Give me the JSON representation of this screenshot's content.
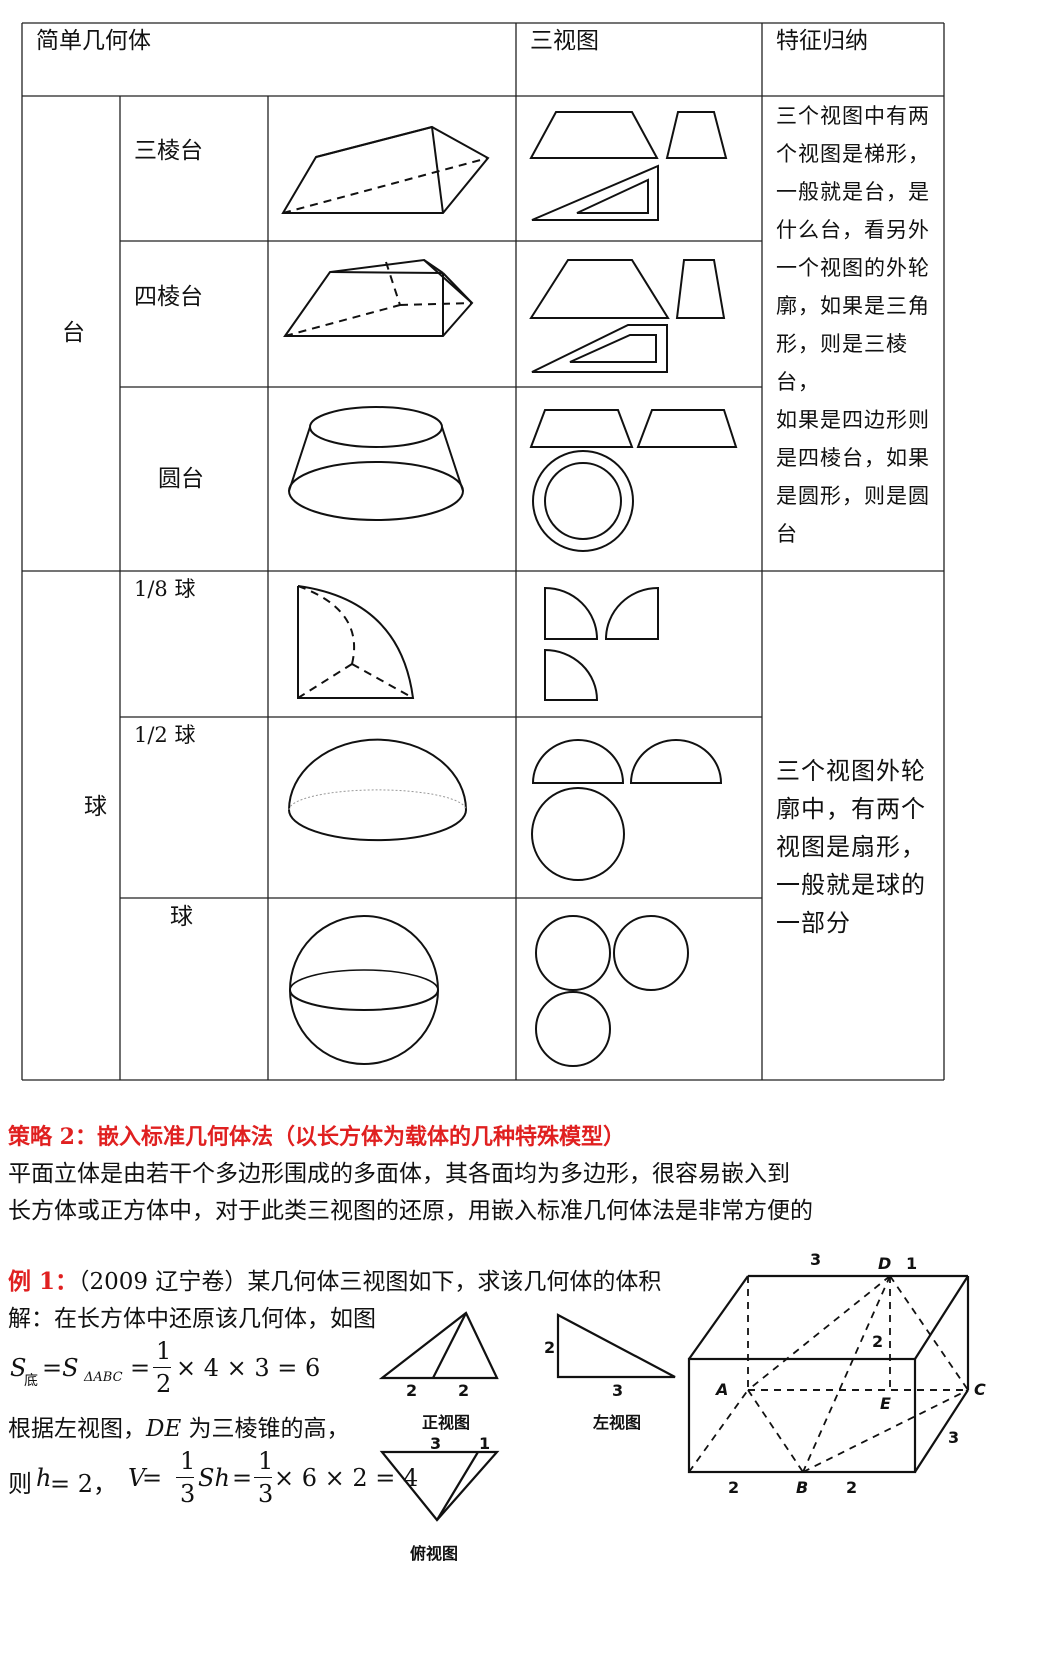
{
  "table": {
    "headers": [
      "简单几何体",
      "三视图",
      "特征归纳"
    ],
    "groups": [
      {
        "name": "台",
        "rows": [
          "三棱台",
          "四棱台",
          "圆台"
        ],
        "feature": [
          "三个视图中有两",
          "个视图是梯形，",
          "一般就是台，是",
          "什么台，看另外",
          "一个视图的外轮",
          "廓，如果是三角",
          "形，则是三棱台，",
          "如果是四边形则",
          "是四棱台，如果",
          "是圆形，则是圆",
          "台"
        ]
      },
      {
        "name": "球",
        "rows": [
          "1/8 球",
          "1/2 球",
          "球"
        ],
        "feature": [
          "三个视图外轮",
          "廓中，有两个",
          "视图是扇形，",
          "一般就是球的",
          "一部分"
        ]
      }
    ]
  },
  "section": {
    "title": "策略 2：嵌入标准几何体法（以长方体为载体的几种特殊模型）",
    "para1": "平面立体是由若干个多边形围成的多面体，其各面均为多边形，很容易嵌入到",
    "para2": "长方体或正方体中，对于此类三视图的还原，用嵌入标准几何体法是非常方便的"
  },
  "example": {
    "label": "例 1：",
    "text": "（2009 辽宁卷）某几何体三视图如下，求该几何体的体积",
    "solution": "解：在长方体中还原该几何体，如图",
    "formula1_lhs": "S",
    "formula1_sub1": "底",
    "formula1_mid": "=S",
    "formula1_sub2": "ΔABC",
    "formula1_rhs": "× 4 × 3 = 6",
    "line3_a": "根据左视图，",
    "line3_b": "DE",
    "line3_c": " 为三棱锥的高，",
    "line4_a": "则 ",
    "line4_b": "h",
    "line4_c": " = 2，",
    "line4_d": "V",
    "line4_e": " = ",
    "line4_f": "Sh",
    "line4_g": " = ",
    "line4_h": "× 6 × 2 = 4",
    "frac_num": "1",
    "frac_den2": "2",
    "frac_den3": "3",
    "views": {
      "front": "正视图",
      "left": "左视图",
      "top": "俯视图",
      "front_dims": [
        "2",
        "2"
      ],
      "left_dims": [
        "2",
        "3"
      ],
      "top_dims": [
        "3",
        "1"
      ]
    },
    "box_labels": {
      "A": "A",
      "B": "B",
      "C": "C",
      "D": "D",
      "E": "E",
      "top3": "3",
      "top1": "1",
      "mid2": "2",
      "right3": "3",
      "bot2a": "2",
      "bot2b": "2"
    }
  }
}
